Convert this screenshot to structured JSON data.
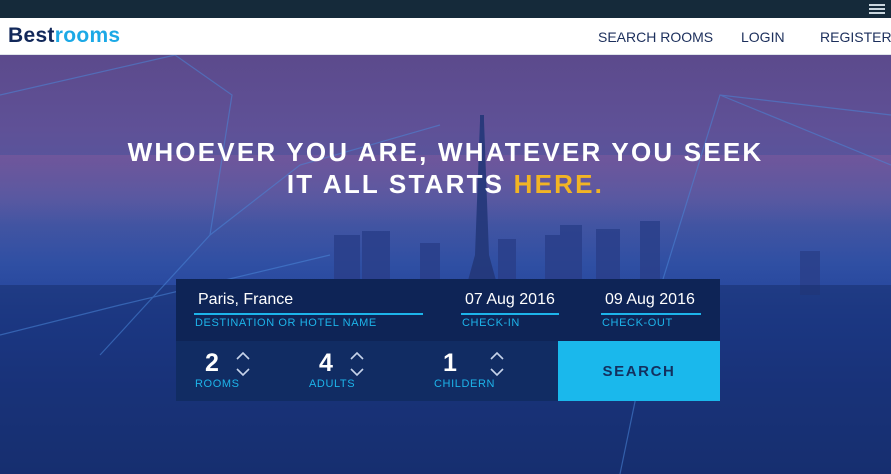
{
  "brand": {
    "part1": "Best",
    "part2": "rooms"
  },
  "nav": {
    "search_rooms": "SEARCH ROOMS",
    "login": "LOGIN",
    "register": "REGISTER"
  },
  "hero": {
    "line1": "WHOEVER YOU ARE, WHATEVER YOU SEEK",
    "line2_prefix": "IT ALL STARTS ",
    "line2_highlight": "HERE."
  },
  "form": {
    "destination": {
      "value": "Paris, France",
      "label": "DESTINATION OR HOTEL NAME"
    },
    "check_in": {
      "value": "07 Aug 2016",
      "label": "CHECK-IN"
    },
    "check_out": {
      "value": "09 Aug 2016",
      "label": "CHECK-OUT"
    },
    "rooms": {
      "value": "2",
      "label": "ROOMS"
    },
    "adults": {
      "value": "4",
      "label": "ADULTS"
    },
    "children": {
      "value": "1",
      "label": "CHILDERN"
    },
    "search_label": "SEARCH"
  },
  "icons": {
    "menu": "hamburger-menu-icon",
    "up": "chevron-up-icon",
    "down": "chevron-down-icon"
  },
  "colors": {
    "brand_dark": "#12285a",
    "brand_accent": "#1ca9e6",
    "highlight": "#f2b424",
    "button": "#1ab8ec",
    "form_bg": "#0e2656"
  }
}
